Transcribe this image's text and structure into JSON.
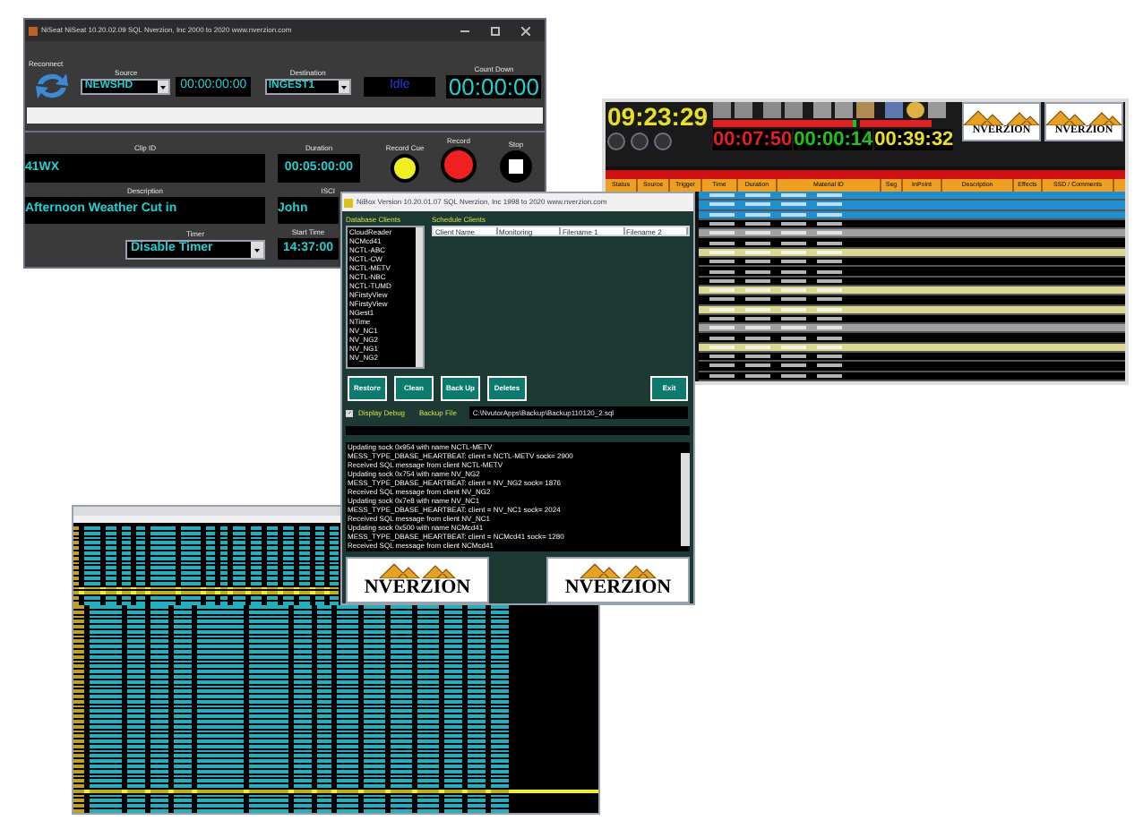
{
  "niseat": {
    "title": "NiSeat NiSeat 10.20.02.09 SQL   Nverzion, Inc 2000 to 2020 www.nverzion.com",
    "reconnect_label": "Reconnect",
    "source_label": "Source",
    "source_value": "NEWSHD",
    "source_timecode": "00:00:00:00",
    "destination_label": "Destination",
    "destination_value": "INGEST1",
    "status": "Idle",
    "countdown_label": "Count Down",
    "countdown": "00:00:00",
    "clip_id_label": "Clip ID",
    "clip_id": "41WX",
    "duration_label": "Duration",
    "duration": "00:05:00:00",
    "record_cue_label": "Record Cue",
    "record_label": "Record",
    "stop_label": "Stop",
    "description_label": "Description",
    "description": "Afternoon Weather Cut in",
    "isci_label": "ISCI",
    "isci_value": "John",
    "timer_label": "Timer",
    "timer_value": "Disable Timer",
    "start_time_label": "Start Time",
    "start_time": "14:37:00"
  },
  "nibox": {
    "title": "NiBox Version 10.20.01.07 SQL Nverzion, Inc 1998 to 2020 www.nverzion.com",
    "database_clients_label": "Database Clients",
    "database_clients": [
      "CloudReader",
      "NCMcd41",
      "NCTL-ABC",
      "NCTL-CW",
      "NCTL-METV",
      "NCTL-NBC",
      "NCTL-TUMD",
      "NFirstyView",
      "NFirstyView",
      "NGest1",
      "NTime",
      "NV_NC1",
      "NV_NG2",
      "NV_NG1",
      "NV_NG2"
    ],
    "schedule_clients_label": "Schedule Clients",
    "schedule_columns": [
      "Client Name",
      "Monitoring",
      "Filename 1",
      "Filename 2"
    ],
    "buttons": [
      "Restore",
      "Clean",
      "Back Up",
      "Deletes"
    ],
    "exit_button": "Exit",
    "display_debug": {
      "label": "Display Debug",
      "checked": true
    },
    "backup_file_label": "Backup File",
    "backup_file": "C:\\NvutorApps\\Backup\\Backup110120_2.sql",
    "log": [
      "Updating sock 0x954 with name NCTL-METV",
      "MESS_TYPE_DBASE_HEARTBEAT: client = NCTL-METV sock= 2900",
      "Received SQL message from client NCTL-METV",
      "Updating sock 0x754 with name NV_NG2",
      "MESS_TYPE_DBASE_HEARTBEAT: client = NV_NG2 sock= 1876",
      "Received SQL message from client NV_NG2",
      "Updating sock 0x7e8 with name NV_NC1",
      "MESS_TYPE_DBASE_HEARTBEAT: client = NV_NC1 sock= 2024",
      "Received SQL message from client NV_NC1",
      "Updating sock 0x500 with name NCMcd41",
      "MESS_TYPE_DBASE_HEARTBEAT: client = NCMcd41 sock= 1280",
      "Received SQL message from client NCMcd41"
    ],
    "logos": [
      "NVERZION",
      "NVERZION"
    ]
  },
  "playlist": {
    "clock": "09:23:29",
    "meters": [
      {
        "level": 0.97
      },
      {
        "level": 1
      }
    ],
    "timers": [
      {
        "value": "00:07:50",
        "color": "#e02020"
      },
      {
        "value": "00:00:14",
        "color": "#20c020"
      },
      {
        "value": "00:39:32",
        "color": "#e8e020"
      }
    ],
    "logos": [
      "NVERZION",
      "NVERZION"
    ],
    "columns": [
      "Status",
      "Source",
      "Trigger",
      "Time",
      "Duration",
      "Material ID",
      "Seg",
      "InPoint",
      "Description",
      "Effects",
      "SSD / Comments"
    ]
  }
}
